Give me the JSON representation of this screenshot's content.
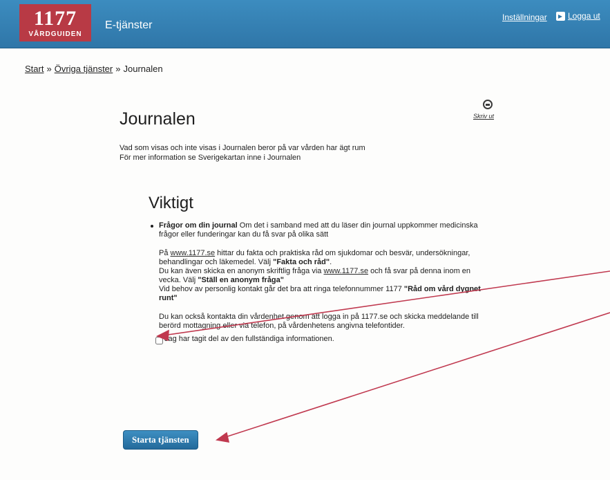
{
  "header": {
    "logo_number": "1177",
    "logo_sub": "VÅRDGUIDEN",
    "app_title": "E-tjänster",
    "settings_label": "Inställningar",
    "logout_label": "Logga ut"
  },
  "breadcrumb": {
    "items": [
      "Start",
      "Övriga tjänster",
      "Journalen"
    ],
    "separator": "»"
  },
  "print": {
    "label": "Skriv ut",
    "icon": "printer-icon"
  },
  "page_title": "Journalen",
  "intro": {
    "line1": "Vad som visas och inte visas i Journalen beror på var vården har ägt rum",
    "line2": "För mer information se Sverigekartan inne i Journalen"
  },
  "section_title": "Viktigt",
  "info": {
    "bullet_heading": "Frågor om din journal",
    "bullet_text": " Om det i samband med att du läser din journal uppkommer medicinska frågor eller funderingar kan du få svar på olika sätt",
    "p1_a": "På ",
    "p1_link": "www.1177.se",
    "p1_b": " hittar du fakta och praktiska råd om sjukdomar och besvär, undersökningar, behandlingar och läkemedel. Välj ",
    "p1_bold": "\"Fakta och råd\"",
    "p1_c": ".",
    "p2_a": "Du kan även skicka en anonym skriftlig fråga via ",
    "p2_link": "www.1177.se",
    "p2_b": " och få svar på denna inom en vecka. Välj ",
    "p2_bold": "\"Ställ en anonym fråga\"",
    "p3_a": "Vid behov av personlig kontakt går det bra att ringa telefonnummer 1177 ",
    "p3_bold": "\"Råd om vård dygnet runt\"",
    "p4": "Du kan också kontakta din vårdenhet genom att logga in på 1177.se och skicka meddelande till berörd mottagning eller via telefon, på vårdenhetens angivna telefontider."
  },
  "consent_label": "Jag har tagit del av den fullständiga informationen.",
  "start_button_label": "Starta tjänsten",
  "annotation_color": "#c0394f"
}
